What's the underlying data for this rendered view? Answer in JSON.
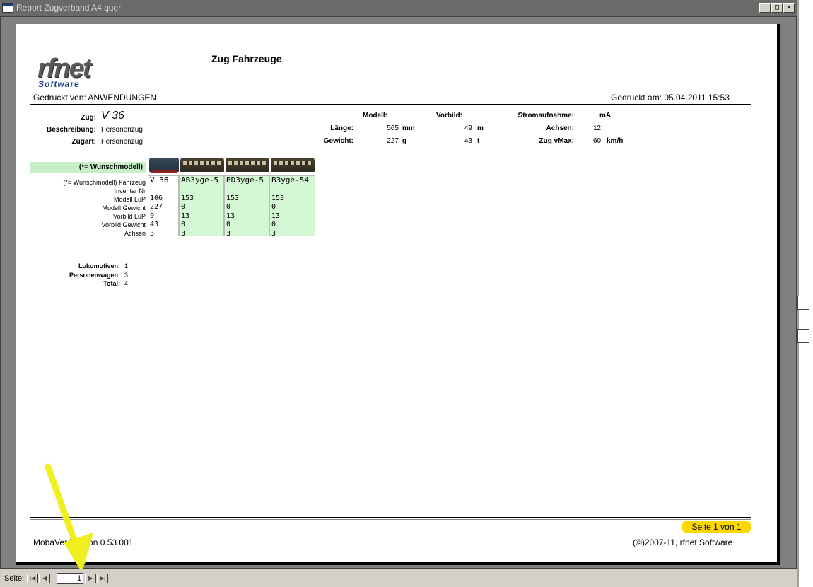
{
  "window": {
    "title": "Report Zugverband A4 quer",
    "buttons": {
      "minimize": "_",
      "maximize": "□",
      "close": "×"
    }
  },
  "report": {
    "logo": {
      "rf": "rfnet",
      "sw": "Software"
    },
    "title": "Zug Fahrzeuge",
    "printed_by_label": "Gedruckt von: ANWENDUNGEN",
    "printed_at_label": "Gedruckt am: 05.04.2011 15:53",
    "train": {
      "zug_label": "Zug:",
      "zug_value": "V 36",
      "beschreibung_label": "Beschreibung:",
      "beschreibung_value": "Personenzug",
      "zugart_label": "Zugart:",
      "zugart_value": "Personenzug",
      "modell_label": "Modell:",
      "vorbild_label": "Vorbild:",
      "stromaufnahme_label": "Stromaufnahme:",
      "stromaufnahme_unit": "mA",
      "laenge_label": "Länge:",
      "laenge_modell": "565",
      "laenge_modell_unit": "mm",
      "laenge_vorbild": "49",
      "laenge_vorbild_unit": "m",
      "achsen_label": "Achsen:",
      "achsen_value": "12",
      "gewicht_label": "Gewicht:",
      "gewicht_modell": "227",
      "gewicht_modell_unit": "g",
      "gewicht_vorbild": "43",
      "gewicht_vorbild_unit": "t",
      "vmax_label": "Zug vMax:",
      "vmax_value": "60",
      "vmax_unit": "km/h"
    },
    "wunsch_banner": "(*= Wunschmodell)",
    "row_labels": [
      "(*= Wunschmodell) Fahrzeug",
      "Inventar Nr",
      "Modell LüP",
      "Modell Gewicht",
      "Vorbild LüP",
      "Vorbild Gewicht",
      "Achsen"
    ],
    "vehicles": [
      {
        "name": "V 36",
        "values": "106\n227\n9\n43\n3"
      },
      {
        "name": "AB3yge-5",
        "values": "153\n0\n13\n0\n3"
      },
      {
        "name": "BD3yge-5",
        "values": "153\n0\n13\n0\n3"
      },
      {
        "name": "B3yge-54",
        "values": "153\n0\n13\n0\n3"
      }
    ],
    "summary": {
      "lok_label": "Lokomotiven:",
      "lok_value": "1",
      "pw_label": "Personenwagen:",
      "pw_value": "3",
      "total_label": "Total:",
      "total_value": "4"
    },
    "footer": {
      "version": "MobaVer Version 0.53.001",
      "page_badge": "Seite 1 von 1",
      "copyright": "(©)2007-11, rfnet Software"
    }
  },
  "statusbar": {
    "seite_label": "Seite:",
    "nav": {
      "first": "|◀",
      "prev": "◀",
      "next": "▶",
      "last": "▶|"
    },
    "page_value": "1"
  },
  "colors": {
    "highlight_green": "#d4f8d4",
    "badge_yellow": "#ffd700",
    "arrow_yellow": "#f0f020"
  }
}
